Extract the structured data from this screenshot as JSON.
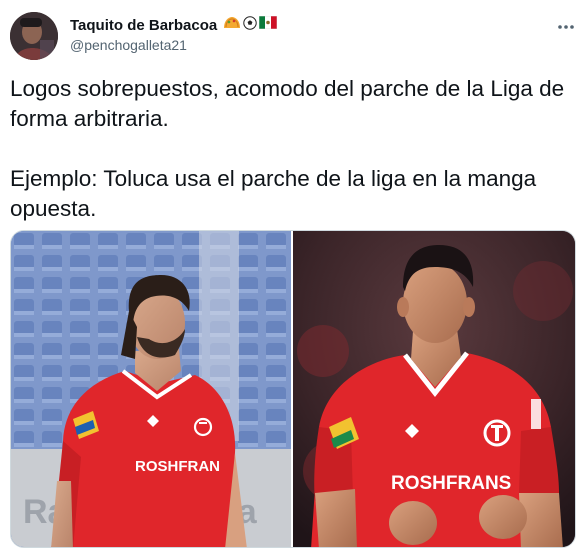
{
  "tweet": {
    "display_name": "Taquito de Barbacoa",
    "handle": "@penchogalleta21",
    "paragraphs": [
      [
        "Logos sobrepuestos, acomodo del parche de la Liga de",
        "forma arbitraria."
      ],
      [
        "Ejemplo: Toluca usa el parche de la liga en la manga",
        "opuesta."
      ]
    ]
  },
  "photos": {
    "left_jersey_sponsor": "ROSHFRAN",
    "left_board_text": "Ra",
    "left_board_text_2": "da",
    "right_jersey_sponsor": "ROSHFRANS"
  },
  "icons": {
    "name_emojis": [
      "taco-icon",
      "soccer-ball-icon",
      "mexico-flag-icon"
    ],
    "more": "more-options-icon"
  },
  "colors": {
    "toluca_red": "#e0262b",
    "text_primary": "#0f1419",
    "text_secondary": "#536471"
  }
}
